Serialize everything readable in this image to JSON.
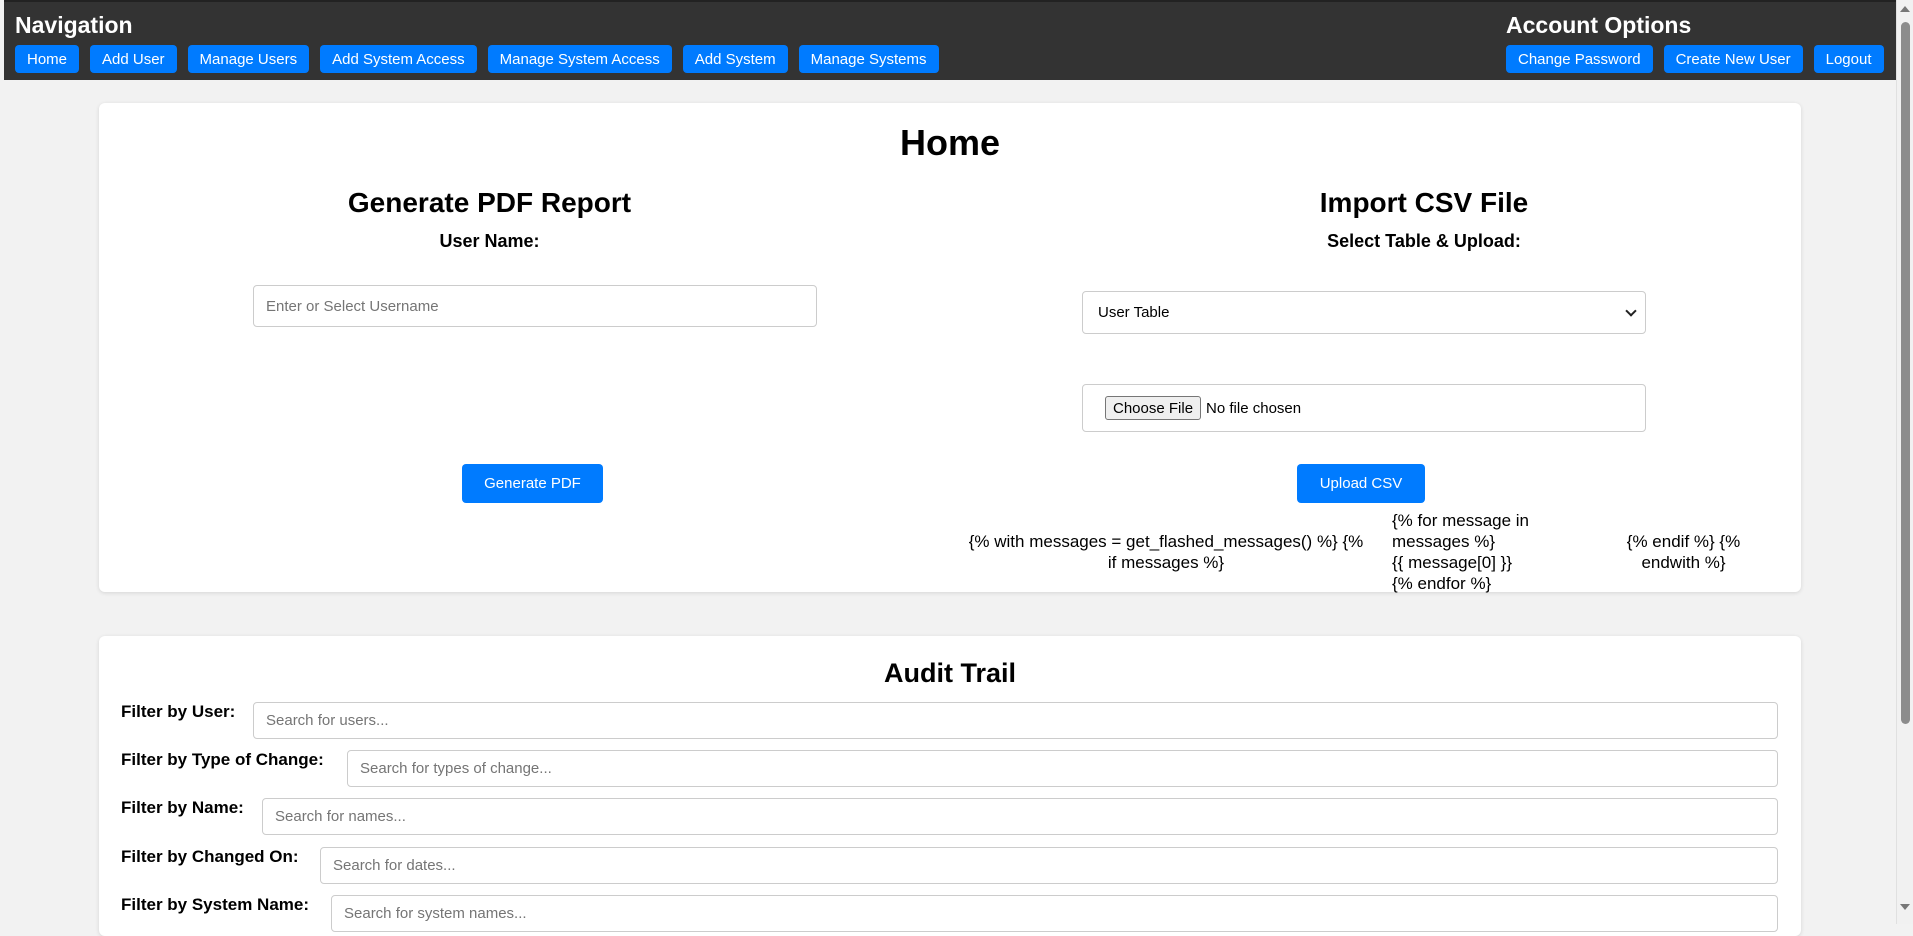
{
  "nav": {
    "title": "Navigation",
    "buttons": [
      "Home",
      "Add User",
      "Manage Users",
      "Add System Access",
      "Manage System Access",
      "Add System",
      "Manage Systems"
    ]
  },
  "account": {
    "title": "Account Options",
    "buttons": [
      "Change Password",
      "Create New User",
      "Logout"
    ]
  },
  "home": {
    "title": "Home",
    "pdf": {
      "title": "Generate PDF Report",
      "label": "User Name:",
      "placeholder": "Enter or Select Username",
      "button": "Generate PDF"
    },
    "csv": {
      "title": "Import CSV File",
      "label": "Select Table & Upload:",
      "selected_table": "User Table",
      "choose_file": "Choose File",
      "no_file": "No file chosen",
      "button": "Upload CSV"
    },
    "template_text": {
      "with_line1": "{% with messages = get_flashed_messages() %} {%",
      "with_line2": "if messages %}",
      "for_line1": "{% for message in",
      "for_line2": "messages %}",
      "for_line3": "{{ message[0] }}",
      "for_line4": "{% endfor %}",
      "end_line1": "{% endif %} {%",
      "end_line2": "endwith %}"
    }
  },
  "audit": {
    "title": "Audit Trail",
    "filters": [
      {
        "label": "Filter by User:",
        "placeholder": "Search for users..."
      },
      {
        "label": "Filter by Type of Change:",
        "placeholder": "Search for types of change..."
      },
      {
        "label": "Filter by Name:",
        "placeholder": "Search for names..."
      },
      {
        "label": "Filter by Changed On:",
        "placeholder": "Search for dates..."
      },
      {
        "label": "Filter by System Name:",
        "placeholder": "Search for system names..."
      }
    ]
  },
  "colors": {
    "navbar_bg": "#333333",
    "accent": "#007bff",
    "page_bg": "#f2f2f2"
  }
}
